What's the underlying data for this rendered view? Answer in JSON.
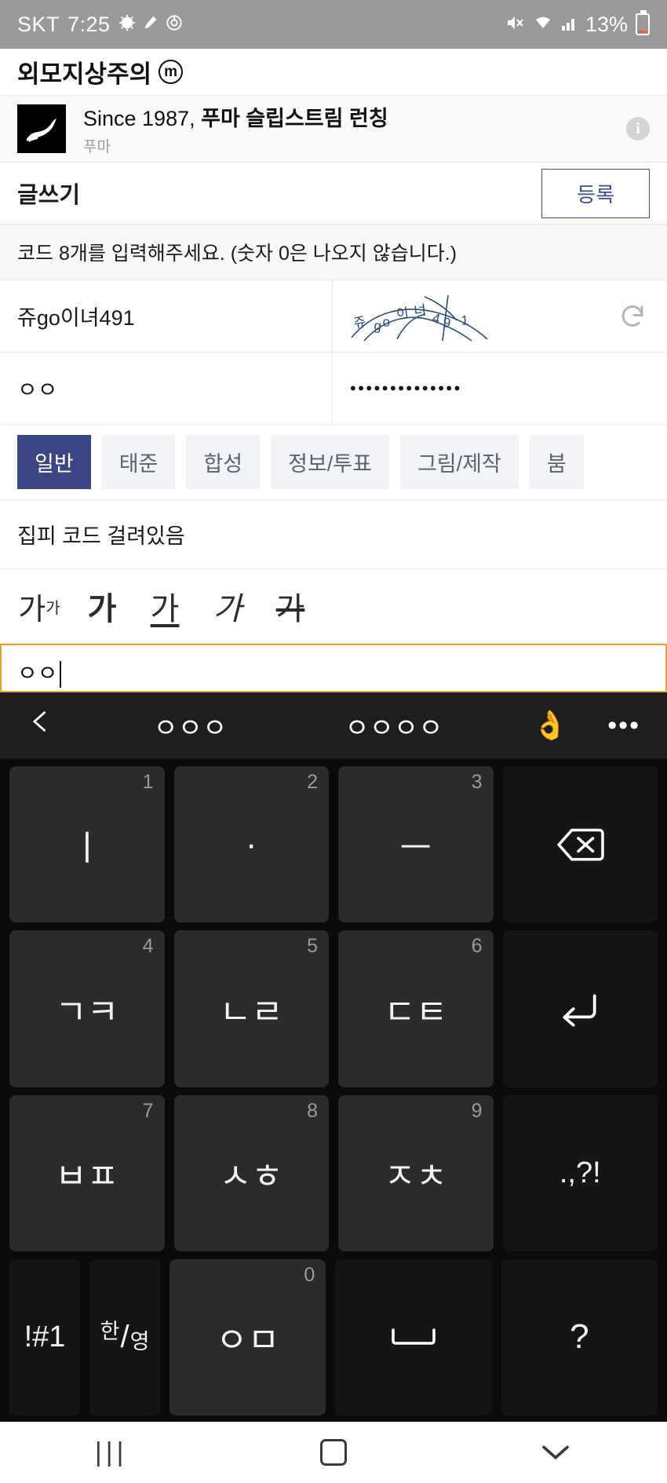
{
  "status_bar": {
    "carrier": "SKT",
    "time": "7:25",
    "left_icons": [
      "alarm-icon",
      "pen-icon",
      "data-saver-icon"
    ],
    "right_icons": [
      "mute-icon",
      "wifi-icon",
      "signal-icon"
    ],
    "battery_percent": "13%"
  },
  "app": {
    "title": "외모지상주의",
    "logo_letter": "m"
  },
  "ad": {
    "title_prefix": "Since 1987, ",
    "title_bold": "푸마 슬립스트림 런칭",
    "advertiser": "푸마",
    "info_icon": "info-icon",
    "thumb": "puma-logo"
  },
  "write_header": {
    "title": "글쓰기",
    "submit_label": "등록"
  },
  "captcha": {
    "notice": "코드 8개를 입력해주세요. (숫자 0은 나오지 않습니다.)",
    "input_value": "쥬go이녀491",
    "image_text": "쥬go이녀491",
    "refresh_icon": "refresh-icon"
  },
  "credentials": {
    "nickname": "ㅇㅇ",
    "password_mask": "••••••••••••••"
  },
  "tabs": [
    {
      "label": "일반",
      "active": true
    },
    {
      "label": "태준",
      "active": false
    },
    {
      "label": "합성",
      "active": false
    },
    {
      "label": "정보/투표",
      "active": false
    },
    {
      "label": "그림/제작",
      "active": false
    },
    {
      "label": "붐",
      "active": false
    }
  ],
  "post": {
    "title": "집피 코드 걸려있음",
    "body": "ㅇㅇ"
  },
  "format_bar": {
    "font_size": "가",
    "font_size_sup": "가",
    "bold": "가",
    "underline": "가",
    "italic": "가",
    "strike": "가"
  },
  "keyboard_toolbar": {
    "back_icon": "chevron-left-icon",
    "suggestion_1": "ㅇㅇㅇ",
    "suggestion_2": "ㅇㅇㅇㅇ",
    "emoji": "👌",
    "more_icon": "•••"
  },
  "keyboard": {
    "rows": [
      [
        {
          "label": "ㅣ",
          "num": "1",
          "type": "char"
        },
        {
          "label": "·",
          "num": "2",
          "type": "char"
        },
        {
          "label": "ㅡ",
          "num": "3",
          "type": "char"
        },
        {
          "label": "backspace-icon",
          "num": "",
          "type": "backspace"
        }
      ],
      [
        {
          "label": "ㄱㅋ",
          "num": "4",
          "type": "char"
        },
        {
          "label": "ㄴㄹ",
          "num": "5",
          "type": "char"
        },
        {
          "label": "ㄷㅌ",
          "num": "6",
          "type": "char"
        },
        {
          "label": "enter-icon",
          "num": "",
          "type": "enter"
        }
      ],
      [
        {
          "label": "ㅂㅍ",
          "num": "7",
          "type": "char"
        },
        {
          "label": "ㅅㅎ",
          "num": "8",
          "type": "char"
        },
        {
          "label": "ㅈㅊ",
          "num": "9",
          "type": "char"
        },
        {
          "label": ".,?!",
          "num": "",
          "type": "punct"
        }
      ],
      [
        {
          "label": "!#1",
          "num": "",
          "type": "symbols"
        },
        {
          "label": "한/영",
          "num": "",
          "type": "lang"
        },
        {
          "label": "ㅇㅁ",
          "num": "0",
          "type": "char"
        },
        {
          "label": "space-icon",
          "num": "",
          "type": "space"
        },
        {
          "label": "?",
          "num": "",
          "type": "question"
        }
      ]
    ],
    "lang_top": "한",
    "lang_bottom": "영"
  },
  "nav_bar": {
    "recents_icon": "|||",
    "home_icon": "home-square-icon",
    "back_icon": "chevron-down-icon"
  },
  "colors": {
    "status_bar_bg": "#9a9a9a",
    "accent_blue": "#3c4685",
    "submit_border": "#3f4c8c",
    "focus_orange": "#e7a33a",
    "keyboard_bg": "#0b0b0b",
    "key_bg": "#2b2b2b",
    "battery_low": "#e8603c"
  }
}
